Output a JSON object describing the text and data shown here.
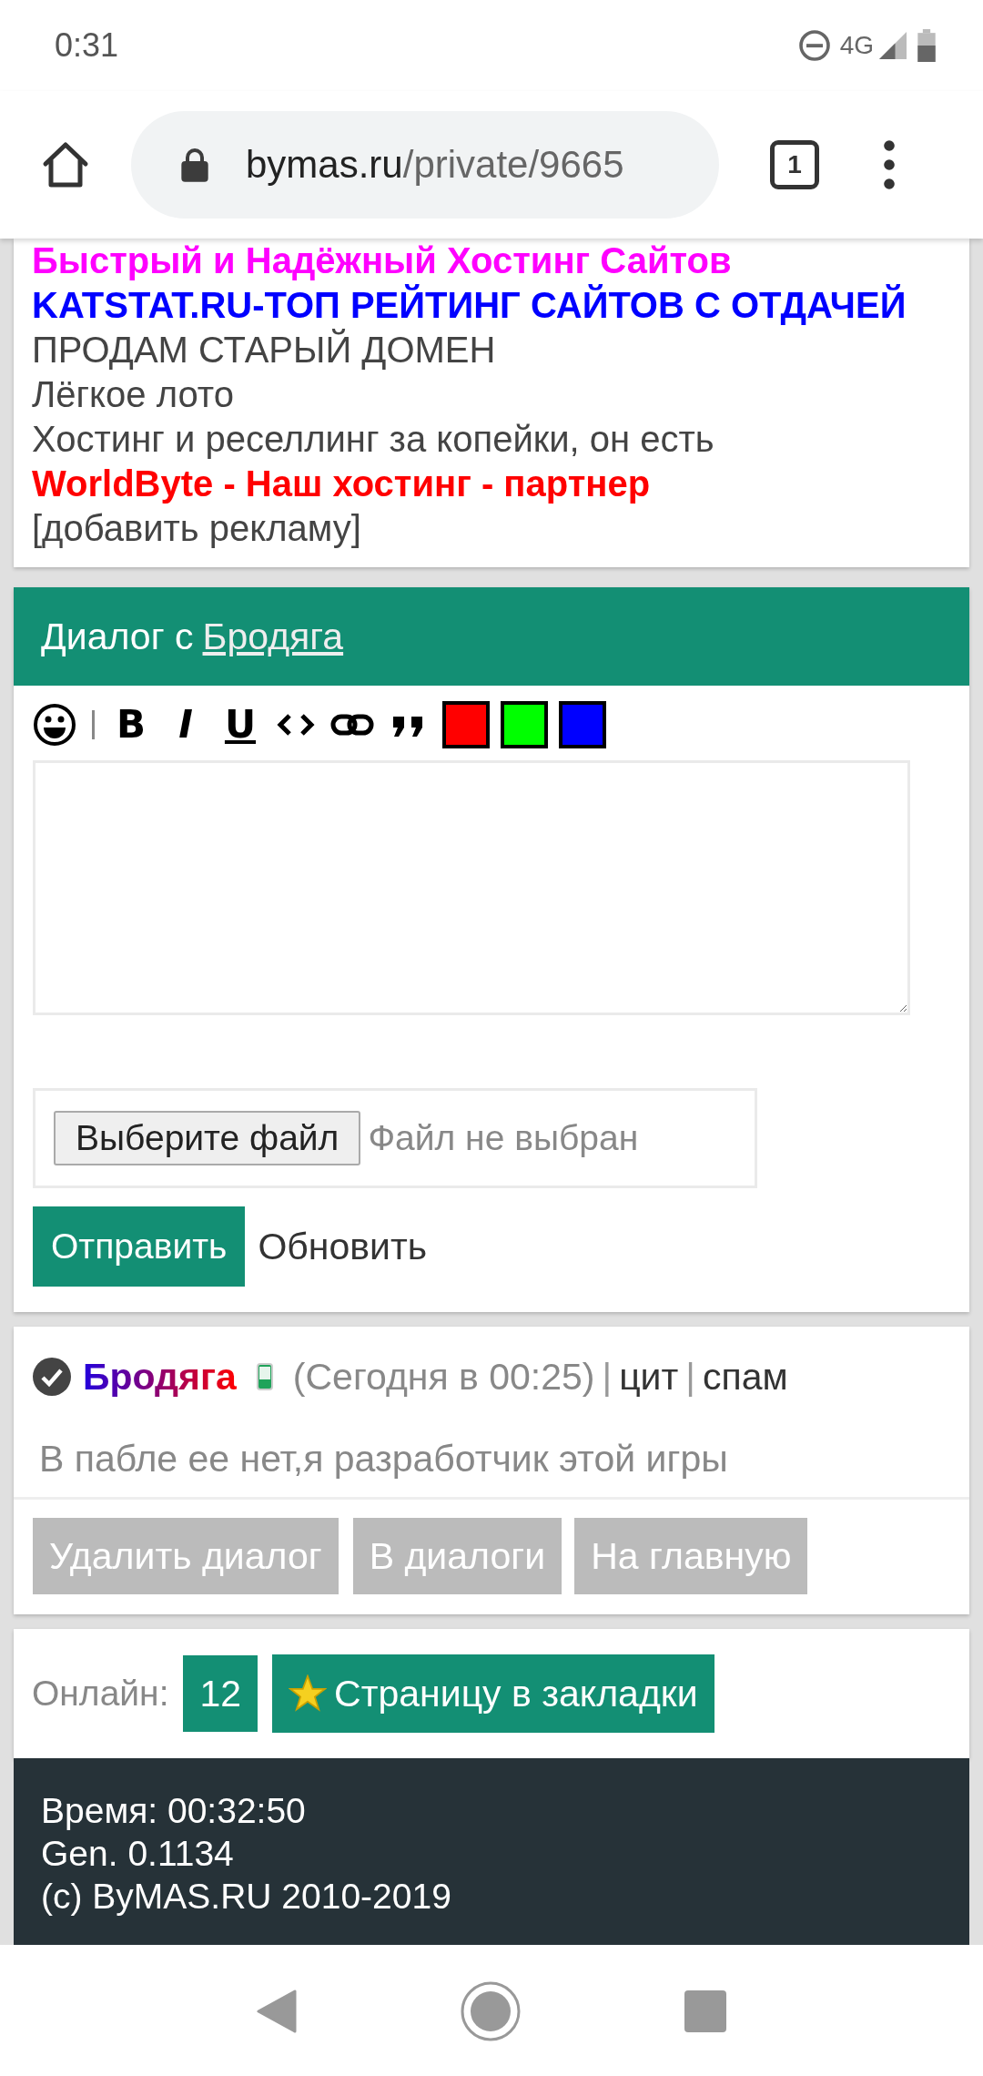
{
  "status_bar": {
    "time": "0:31",
    "network": "4G"
  },
  "browser": {
    "domain": "bymas.ru",
    "path": "/private/9665",
    "tab_count": "1"
  },
  "ads": [
    {
      "text": "Быстрый и Надёжный Хостинг Сайтов",
      "color": "#ff00ff",
      "bold": true
    },
    {
      "text": "KATSTAT.RU-ТОП РЕЙТИНГ САЙТОВ С ОТДАЧЕЙ",
      "color": "#0000ff",
      "bold": true
    },
    {
      "text": "ПРОДАМ СТАРЫЙ ДОМЕН",
      "color": "#444444",
      "bold": false
    },
    {
      "text": "Лёгкое лото",
      "color": "#444444",
      "bold": false
    },
    {
      "text": "Хостинг и реселлинг за копейки, он есть",
      "color": "#444444",
      "bold": false
    },
    {
      "text": "WorldByte - Наш хостинг - партнер",
      "color": "#ff0000",
      "bold": true
    },
    {
      "text": "[добавить рекламу]",
      "color": "#444444",
      "bold": false
    }
  ],
  "dialog": {
    "title": "Диалог с",
    "user": "Бродяга",
    "toolbar": [
      {
        "kind": "smiley"
      },
      {
        "kind": "separator"
      },
      {
        "kind": "bold",
        "label": "B"
      },
      {
        "kind": "italic",
        "label": "I"
      },
      {
        "kind": "underline",
        "label": "U"
      },
      {
        "kind": "code"
      },
      {
        "kind": "link"
      },
      {
        "kind": "quote"
      },
      {
        "kind": "color",
        "color": "#ff0000"
      },
      {
        "kind": "color",
        "color": "#00ff00"
      },
      {
        "kind": "color",
        "color": "#0000ff"
      }
    ],
    "file_button": "Выберите файл",
    "file_status": "Файл не выбран",
    "send_button": "Отправить",
    "refresh_link": "Обновить"
  },
  "message": {
    "author": "Бродяга",
    "time": "(Сегодня в 00:25)",
    "separator_1": "|",
    "quote_link": "цит",
    "separator_2": "|",
    "spam_link": "спам",
    "text": "В пабле ее нет,я разработчик этой игры"
  },
  "actions": [
    "Удалить диалог",
    "В диалоги",
    "На главную"
  ],
  "online": {
    "label": "Онлайн:",
    "count": "12",
    "bookmark": "Страницу в закладки"
  },
  "footer": [
    "Время: 00:32:50",
    "Gen. 0.1134",
    "(c) ByMAS.RU 2010-2019"
  ]
}
